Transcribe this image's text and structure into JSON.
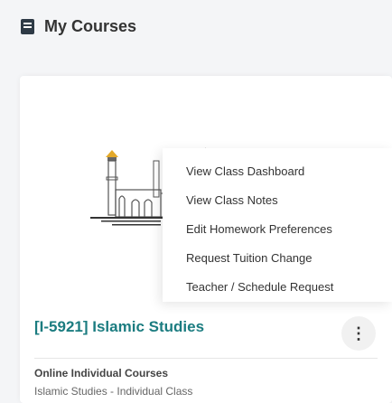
{
  "header": {
    "title": "My Courses",
    "icon": "book-icon"
  },
  "course": {
    "title": "[I-5921] Islamic Studies",
    "type": "Online Individual Courses",
    "subtitle": "Islamic Studies - Individual Class",
    "menu_icon": "more-vertical-icon"
  },
  "menu": {
    "items": [
      {
        "label": "View Class Dashboard"
      },
      {
        "label": "View Class Notes"
      },
      {
        "label": "Edit Homework Preferences"
      },
      {
        "label": "Request Tuition Change"
      },
      {
        "label": "Teacher / Schedule Request"
      }
    ]
  },
  "colors": {
    "accent": "#1b7c80",
    "gold": "#e3a92a",
    "text": "#333333"
  }
}
